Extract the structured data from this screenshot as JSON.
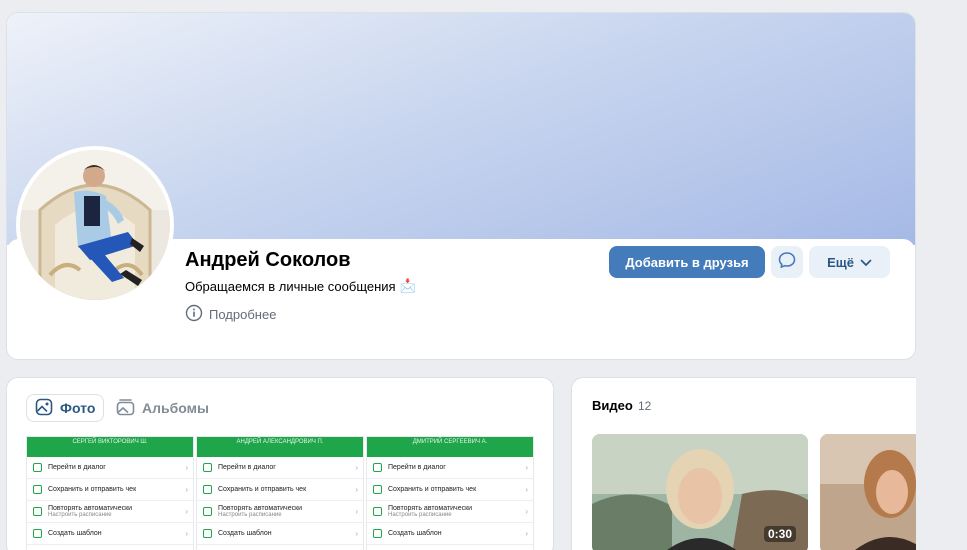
{
  "profile": {
    "name": "Андрей Соколов",
    "status": "Обращаемся в личные сообщения",
    "status_emoji": "📩",
    "more_info": "Подробнее",
    "add_friend": "Добавить в друзья",
    "more": "Ещё"
  },
  "photos": {
    "tab_photos": "Фото",
    "tab_albums": "Альбомы",
    "thumbs": [
      {
        "header": "СЕРГЕЙ ВИКТОРОВИЧ Ш."
      },
      {
        "header": "АНДРЕЙ АЛЕКСАНДРОВИЧ П."
      },
      {
        "header": "ДМИТРИЙ СЕРГЕЕВИЧ А."
      }
    ],
    "rows": {
      "go_dialog": "Перейти в диалог",
      "save_send": "Сохранить и отправить чек",
      "repeat_auto": "Повторять автоматически",
      "repeat_sub": "Настроить расписание",
      "create_template": "Создать шаблон"
    }
  },
  "video": {
    "title": "Видео",
    "count": "12",
    "items": [
      {
        "duration": "0:30"
      },
      {
        "duration": ""
      }
    ]
  },
  "colors": {
    "accent": "#447bba",
    "link": "#2a5885",
    "secondary_bg": "#eaf0f7",
    "page_bg": "#ebedf0",
    "thumb_green": "#1fa54a"
  }
}
